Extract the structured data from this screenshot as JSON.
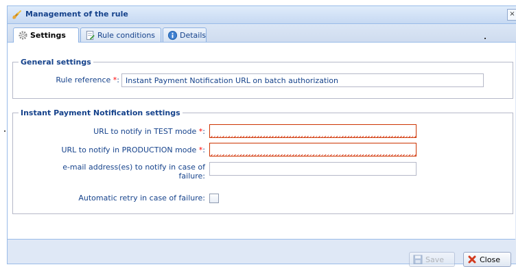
{
  "window": {
    "title": "Management of the rule",
    "close_glyph": "×",
    "title_icon": "wrench-icon"
  },
  "tabs": [
    {
      "label": "Settings",
      "icon": "gear-icon",
      "active": true
    },
    {
      "label": "Rule conditions",
      "icon": "document-edit-icon",
      "active": false
    },
    {
      "label": "Details",
      "icon": "info-icon",
      "active": false
    }
  ],
  "general_settings": {
    "legend": "General settings",
    "rule_reference": {
      "label": "Rule reference",
      "required_mark": "*",
      "label_suffix": ":",
      "value": "Instant Payment Notification URL on batch authorization"
    }
  },
  "ipn_settings": {
    "legend": "Instant Payment Notification settings",
    "url_test": {
      "label": "URL to notify in TEST mode",
      "required_mark": "*",
      "label_suffix": ":",
      "value": ""
    },
    "url_production": {
      "label": "URL to notify in PRODUCTION mode",
      "required_mark": "*",
      "label_suffix": ":",
      "value": ""
    },
    "email": {
      "label": "e-mail address(es) to notify in case of failure:",
      "value": ""
    },
    "retry": {
      "label": "Automatic retry in case of failure:",
      "checked": false
    }
  },
  "footer": {
    "save_label": "Save",
    "close_label": "Close"
  },
  "colors": {
    "accent": "#15428b",
    "border": "#99bbe8",
    "required": "#ff0000",
    "invalid": "#cc3300"
  }
}
